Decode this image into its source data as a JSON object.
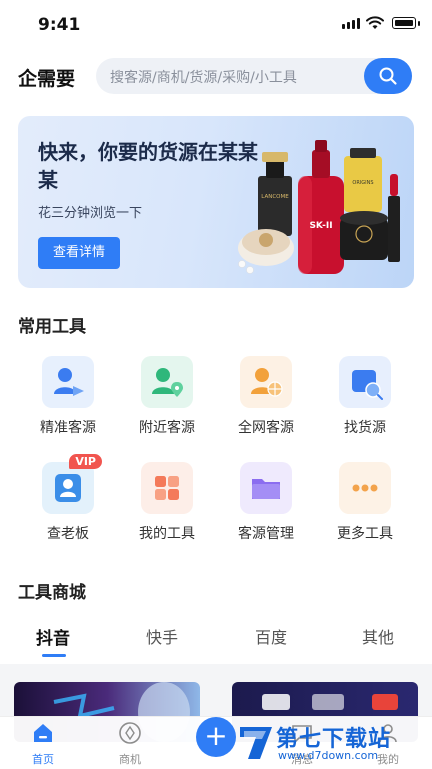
{
  "status": {
    "time": "9:41"
  },
  "header": {
    "brand": "企需要",
    "search_placeholder": "搜客源/商机/货源/采购/小工具"
  },
  "banner": {
    "title": "快来，你要的货源在某某某",
    "subtitle": "花三分钟浏览一下",
    "button": "查看详情",
    "product_labels": {
      "lancome": "LANCOME",
      "skii": "SK-II",
      "origins": "ORIGINS"
    }
  },
  "tools_section": {
    "title": "常用工具",
    "items": [
      {
        "label": "精准客源",
        "icon": "target-customer-icon"
      },
      {
        "label": "附近客源",
        "icon": "nearby-customer-icon"
      },
      {
        "label": "全网客源",
        "icon": "global-customer-icon"
      },
      {
        "label": "找货源",
        "icon": "find-supply-icon"
      },
      {
        "label": "查老板",
        "icon": "boss-lookup-icon",
        "badge": "VIP"
      },
      {
        "label": "我的工具",
        "icon": "my-tools-icon"
      },
      {
        "label": "客源管理",
        "icon": "folder-icon"
      },
      {
        "label": "更多工具",
        "icon": "more-icon"
      }
    ]
  },
  "shop_section": {
    "title": "工具商城",
    "tabs": [
      "抖音",
      "快手",
      "百度",
      "其他"
    ],
    "active_tab": "抖音"
  },
  "bottom_nav": {
    "items": [
      "首页",
      "商机",
      "消息",
      "我的"
    ],
    "active": "首页"
  },
  "watermark": {
    "text": "第七下载站",
    "url": "www.d7down.com"
  },
  "colors": {
    "accent": "#2f7df6",
    "vip": "#f1554f"
  }
}
